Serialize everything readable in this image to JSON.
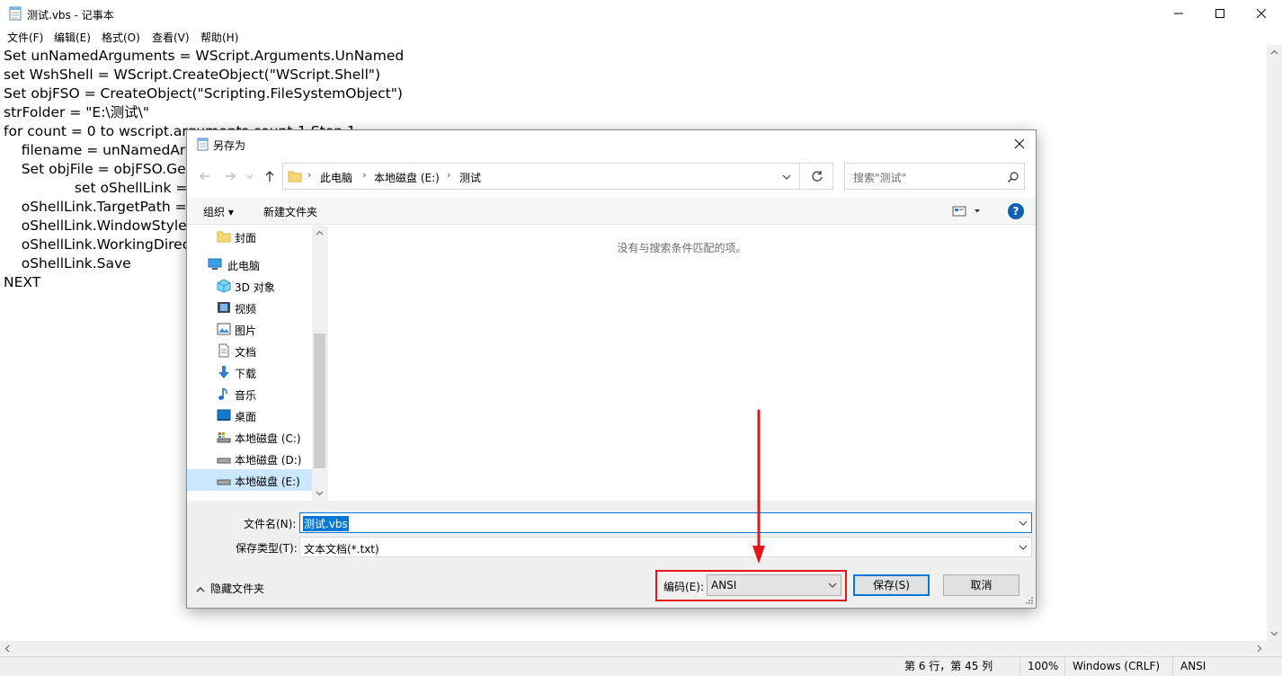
{
  "notepad": {
    "title": "测试.vbs - 记事本",
    "menu": [
      "文件(F)",
      "编辑(E)",
      "格式(O)",
      "查看(V)",
      "帮助(H)"
    ],
    "code_lines": [
      "Set unNamedArguments = WScript.Arguments.UnNamed",
      "set WshShell = WScript.CreateObject(\"WScript.Shell\")",
      "Set objFSO = CreateObject(\"Scripting.FileSystemObject\")",
      "strFolder = \"E:\\测试\\\"",
      "for count = 0 to wscript.arguments.count-1 Step 1",
      "    filename = unNamedArg",
      "    Set objFile = objFSO.Get",
      "                set oShellLink =",
      "    oShellLink.TargetPath =",
      "    oShellLink.WindowStyle",
      "    oShellLink.WorkingDirec",
      "    oShellLink.Save",
      "NEXT"
    ],
    "status": {
      "position": "第 6 行，第 45 列",
      "zoom": "100%",
      "line_ending": "Windows (CRLF)",
      "encoding": "ANSI"
    }
  },
  "dialog": {
    "title": "另存为",
    "breadcrumb": [
      "此电脑",
      "本地磁盘 (E:)",
      "测试"
    ],
    "search_placeholder": "搜索\"测试\"",
    "toolbar": {
      "organize": "组织 ▾",
      "new_folder": "新建文件夹",
      "help": "?"
    },
    "nav_items": [
      {
        "label": "封面",
        "icon": "folder-icon"
      },
      {
        "label": "此电脑",
        "icon": "computer-icon"
      },
      {
        "label": "3D 对象",
        "icon": "cube-icon"
      },
      {
        "label": "视频",
        "icon": "video-icon"
      },
      {
        "label": "图片",
        "icon": "picture-icon"
      },
      {
        "label": "文档",
        "icon": "document-icon"
      },
      {
        "label": "下载",
        "icon": "download-icon"
      },
      {
        "label": "音乐",
        "icon": "music-icon"
      },
      {
        "label": "桌面",
        "icon": "desktop-icon"
      },
      {
        "label": "本地磁盘 (C:)",
        "icon": "drive-icon"
      },
      {
        "label": "本地磁盘 (D:)",
        "icon": "drive-icon"
      },
      {
        "label": "本地磁盘 (E:)",
        "icon": "drive-icon"
      }
    ],
    "empty_message": "没有与搜索条件匹配的项。",
    "filename_label": "文件名(N):",
    "filename_value": "测试.vbs",
    "filetype_label": "保存类型(T):",
    "filetype_value": "文本文档(*.txt)",
    "hide_folders": "隐藏文件夹",
    "encoding_label": "编码(E):",
    "encoding_value": "ANSI",
    "save_button": "保存(S)",
    "cancel_button": "取消",
    "annotation_color": "#e3161b"
  }
}
